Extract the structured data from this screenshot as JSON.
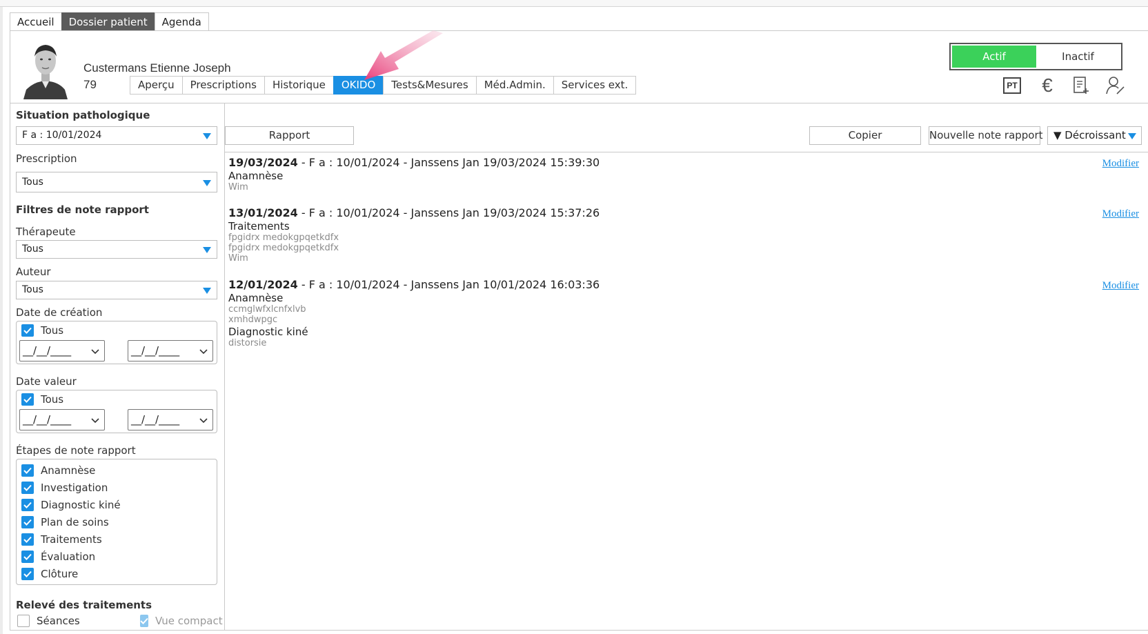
{
  "main_tabs": [
    "Accueil",
    "Dossier patient",
    "Agenda"
  ],
  "patient": {
    "name": "Custermans Etienne Joseph",
    "age": "79"
  },
  "sub_tabs": [
    "Aperçu",
    "Prescriptions",
    "Historique",
    "OKIDO",
    "Tests&Mesures",
    "Méd.Admin.",
    "Services ext."
  ],
  "status_toggle": {
    "on": "Actif",
    "off": "Inactif",
    "on_color": "#3bd15a"
  },
  "header_icons": [
    "pt-icon",
    "euro-icon",
    "document-add-icon",
    "user-edit-icon"
  ],
  "pt_label": "PT",
  "left": {
    "situation_label": "Situation pathologique",
    "situation_value": "F a : 10/01/2024",
    "prescription_label": "Prescription",
    "prescription_value": "Tous",
    "filters_label": "Filtres de note rapport",
    "therapeute_label": "Thérapeute",
    "therapeute_value": "Tous",
    "auteur_label": "Auteur",
    "auteur_value": "Tous",
    "date_creation_label": "Date de création",
    "date_creation_all": "Tous",
    "date_valeur_label": "Date valeur",
    "date_valeur_all": "Tous",
    "date_placeholder": "__/__/____",
    "etapes_label": "Étapes de note rapport",
    "etapes": [
      "Anamnèse",
      "Investigation",
      "Diagnostic kiné",
      "Plan de soins",
      "Traitements",
      "Évaluation",
      "Clôture"
    ],
    "releve_label": "Relevé des traitements",
    "seances_label": "Séances",
    "vue_compacte_label": "Vue compacte"
  },
  "toolbar": {
    "rapport": "Rapport",
    "copier": "Copier",
    "nouvelle_note": "Nouvelle note rapport",
    "sort": "▼ Décroissant"
  },
  "notes": [
    {
      "date": "19/03/2024",
      "rest": " - F a : 10/01/2024 - Janssens Jan 19/03/2024 15:39:30",
      "modifier": "Modifier",
      "sections": [
        {
          "title": "Anamnèse",
          "lines": [
            "Wim"
          ]
        }
      ]
    },
    {
      "date": "13/01/2024",
      "rest": " - F a : 10/01/2024 - Janssens Jan 19/03/2024 15:37:26",
      "modifier": "Modifier",
      "sections": [
        {
          "title": "Traitements",
          "lines": [
            "fpgidrx medokgpqetkdfx",
            "fpgidrx medokgpqetkdfx",
            "Wim"
          ]
        }
      ]
    },
    {
      "date": "12/01/2024",
      "rest": " - F a : 10/01/2024 - Janssens Jan 10/01/2024 16:03:36",
      "modifier": "Modifier",
      "sections": [
        {
          "title": "Anamnèse",
          "lines": [
            "ccmglwfxlcnfxlvb",
            "xmhdwpgc"
          ]
        },
        {
          "title": "Diagnostic kiné",
          "lines": [
            "distorsie"
          ]
        }
      ]
    }
  ]
}
